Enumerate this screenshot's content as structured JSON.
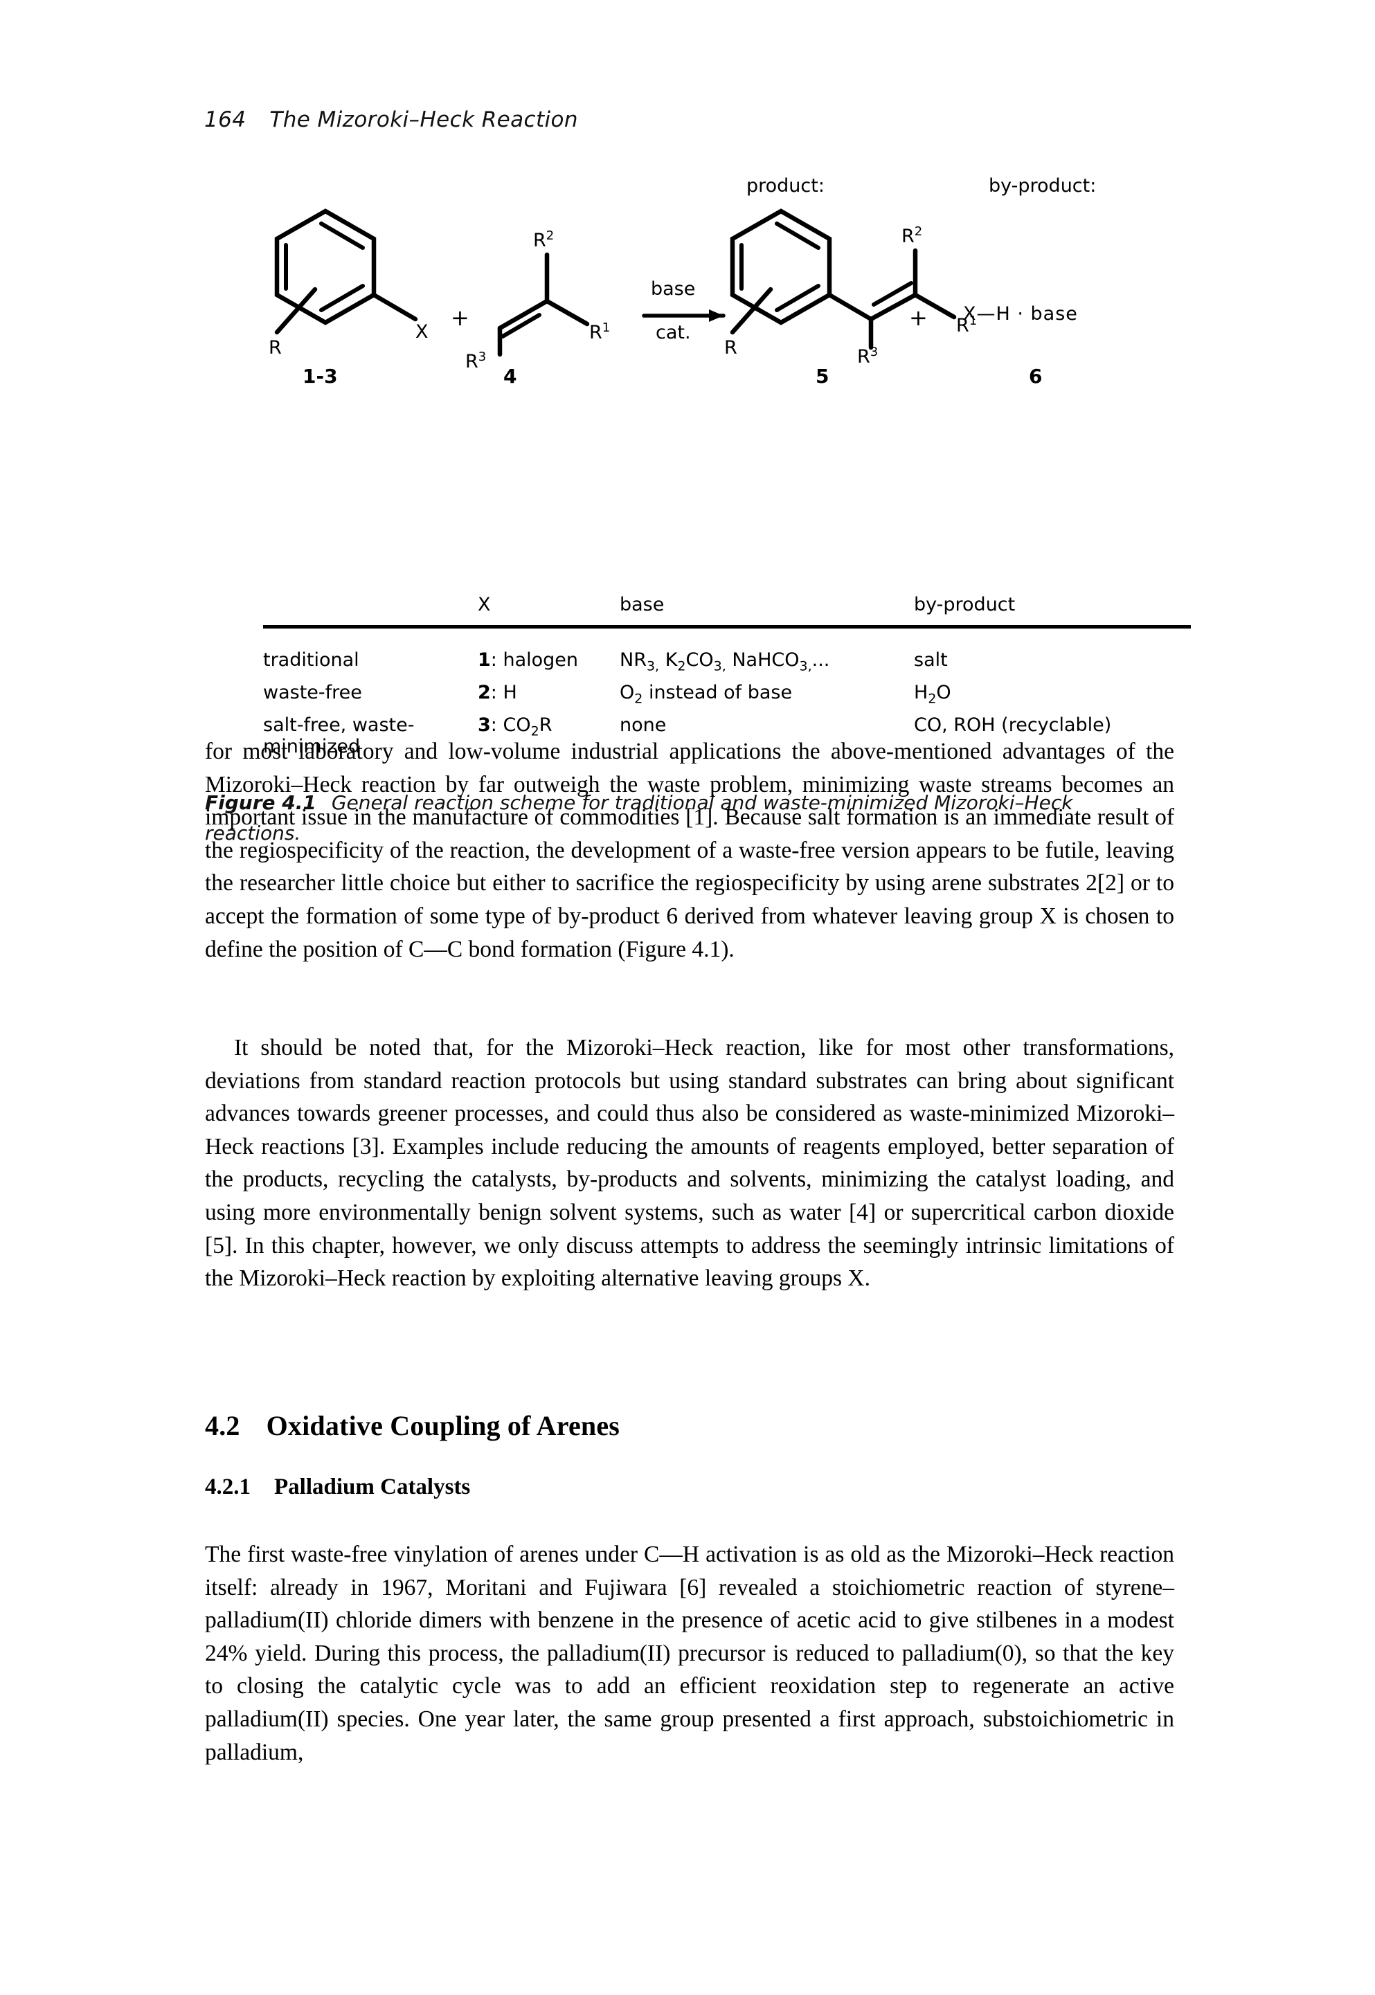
{
  "running_head": {
    "page_number": "164",
    "title": "The Mizoroki–Heck Reaction"
  },
  "figure": {
    "scheme": {
      "reactant1": {
        "ring_substituent": "R",
        "leaving_group": "X",
        "compound_label": "1-3"
      },
      "plus1": "+",
      "reactant2": {
        "sub_top": "R",
        "sub_top_sup": "2",
        "sub_right": "R",
        "sub_right_sup": "1",
        "sub_bottom": "R",
        "sub_bottom_sup": "3",
        "compound_label": "4"
      },
      "arrow": {
        "above": "base",
        "below": "cat."
      },
      "product_header": "product:",
      "product": {
        "ring_substituent": "R",
        "sub_top": "R",
        "sub_top_sup": "2",
        "sub_right": "R",
        "sub_right_sup": "1",
        "sub_bottom": "R",
        "sub_bottom_sup": "3",
        "compound_label": "5"
      },
      "plus2": "+",
      "byproduct_header": "by-product:",
      "byproduct": {
        "formula": "X—H · base",
        "compound_label": "6"
      }
    },
    "table": {
      "headers": [
        "",
        "X",
        "base",
        "by-product"
      ],
      "rows": [
        {
          "category": "traditional",
          "x_compound": "1",
          "x_value": ": halogen",
          "base": "NR3, K2CO3, NaHCO3,...",
          "base_parts": [
            {
              "t": "NR",
              "s": "3,"
            },
            {
              "t": " K",
              "s": "2"
            },
            {
              "t": "CO",
              "s": "3,"
            },
            {
              "t": " NaHCO",
              "s": "3,"
            },
            {
              "t": "..."
            }
          ],
          "byproduct": "salt"
        },
        {
          "category": "waste-free",
          "x_compound": "2",
          "x_value": ": H",
          "base": "O2 instead of base",
          "byproduct": "H2O"
        },
        {
          "category": "salt-free, waste-minimized",
          "x_compound": "3",
          "x_value": ": CO2R",
          "base": "none",
          "byproduct": "CO, ROH (recyclable)"
        }
      ]
    },
    "caption": {
      "number": "Figure 4.1",
      "text": "General reaction scheme for traditional and waste-minimized Mizoroki–Heck reactions."
    }
  },
  "body": {
    "paragraph_1": "for most laboratory and low-volume industrial applications the above-mentioned advantages of the Mizoroki–Heck reaction by far outweigh the waste problem, minimizing waste streams becomes an important issue in the manufacture of commodities [1]. Because salt formation is an immediate result of the regiospecificity of the reaction, the development of a waste-free version appears to be futile, leaving the researcher little choice but either to sacrifice the regiospecificity by using arene substrates 2[2] or to accept the formation of some type of by-product 6 derived from whatever leaving group X is chosen to define the position of C—C bond formation (Figure 4.1).",
    "paragraph_2": "It should be noted that, for the Mizoroki–Heck reaction, like for most other transformations, deviations from standard reaction protocols but using standard substrates can bring about significant advances towards greener processes, and could thus also be considered as waste-minimized Mizoroki–Heck reactions [3]. Examples include reducing the amounts of reagents employed, better separation of the products, recycling the catalysts, by-products and solvents, minimizing the catalyst loading, and using more environmentally benign solvent systems, such as water [4] or supercritical carbon dioxide [5]. In this chapter, however, we only discuss attempts to address the seemingly intrinsic limitations of the Mizoroki–Heck reaction by exploiting alternative leaving groups X.",
    "paragraph_3": "The first waste-free vinylation of arenes under C—H activation is as old as the Mizoroki–Heck reaction itself: already in 1967, Moritani and Fujiwara [6] revealed a stoichiometric reaction of styrene–palladium(II) chloride dimers with benzene in the presence of acetic acid to give stilbenes in a modest 24% yield. During this process, the palladium(II) precursor is reduced to palladium(0), so that the key to closing the catalytic cycle was to add an efficient reoxidation step to regenerate an active palladium(II) species. One year later, the same group presented a first approach, substoichiometric in palladium,"
  },
  "headings": {
    "section": {
      "number": "4.2",
      "title": "Oxidative Coupling of Arenes"
    },
    "subsection": {
      "number": "4.2.1",
      "title": "Palladium Catalysts"
    }
  },
  "colors": {
    "text": "#000000",
    "background": "#ffffff"
  }
}
